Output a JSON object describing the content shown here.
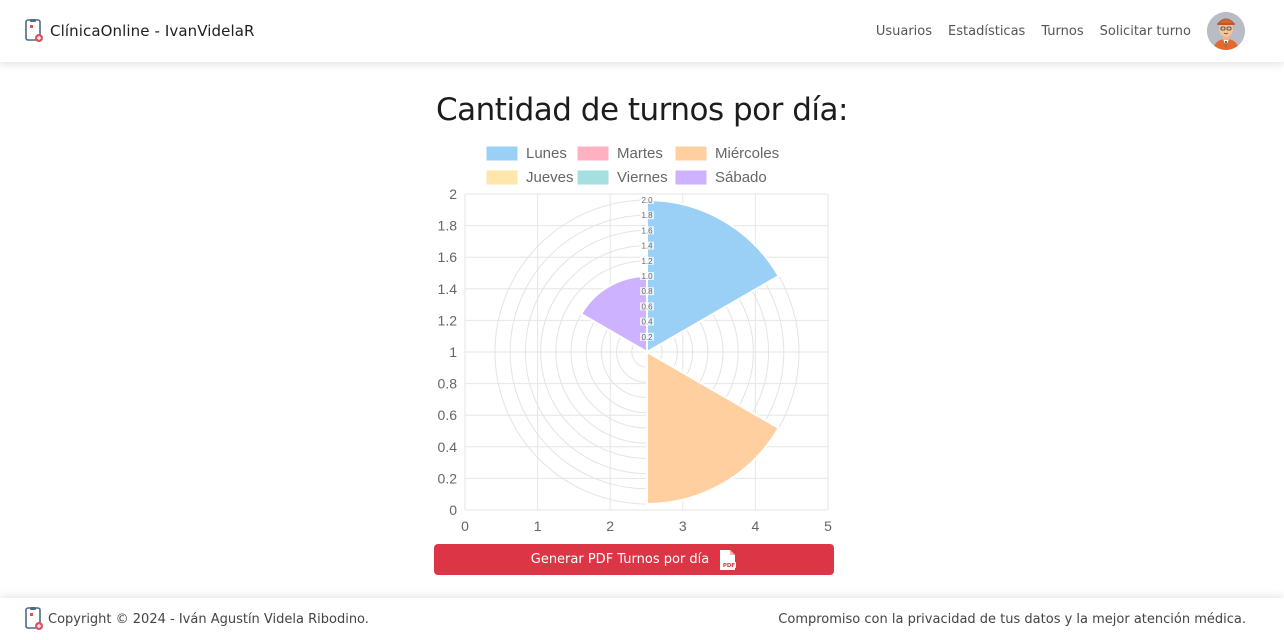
{
  "navbar": {
    "brand": "ClínicaOnline - IvanVidelaR",
    "links": [
      "Usuarios",
      "Estadísticas",
      "Turnos",
      "Solicitar turno"
    ]
  },
  "main": {
    "title": "Cantidad de turnos por día:",
    "pdf_button_label": "Generar PDF Turnos por día"
  },
  "chart_data": {
    "type": "polarArea",
    "categories": [
      "Lunes",
      "Martes",
      "Miércoles",
      "Jueves",
      "Viernes",
      "Sábado"
    ],
    "values": [
      2,
      0,
      2,
      0,
      0,
      1
    ],
    "colors": [
      "#9ad0f5",
      "#ffb1c1",
      "#ffcf9f",
      "#ffe6aa",
      "#a5dfdf",
      "#ccb2ff"
    ],
    "legend_position": "top",
    "x_ticks": [
      "0",
      "1",
      "2",
      "3",
      "4",
      "5"
    ],
    "y_ticks": [
      "0",
      "0.2",
      "0.4",
      "0.6",
      "0.8",
      "1",
      "1.2",
      "1.4",
      "1.6",
      "1.8",
      "2"
    ],
    "radial_ticks": [
      "0.2",
      "0.4",
      "0.6",
      "0.8",
      "1.0",
      "1.2",
      "1.4",
      "1.6",
      "1.8",
      "2.0"
    ],
    "radial_max": 2,
    "grid": true
  },
  "footer": {
    "copyright": "Copyright © 2024 - Iván Agustín Videla Ribodino.",
    "tagline": "Compromiso con la privacidad de tus datos y la mejor atención médica."
  }
}
